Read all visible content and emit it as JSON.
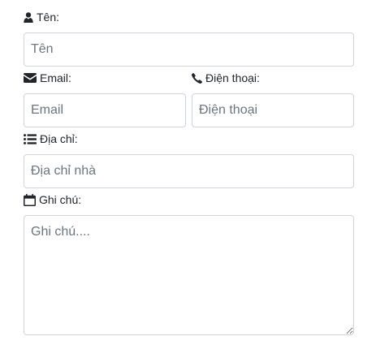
{
  "form": {
    "name": {
      "label": "Tên:",
      "placeholder": "Tên"
    },
    "email": {
      "label": "Email:",
      "placeholder": "Email"
    },
    "phone": {
      "label": "Điện thoại:",
      "placeholder": "Điện thoại"
    },
    "address": {
      "label": "Địa chỉ:",
      "placeholder": "Địa chỉ nhà"
    },
    "note": {
      "label": "Ghi chú:",
      "placeholder": "Ghi chú...."
    }
  },
  "icons": {
    "name": "user-icon",
    "email": "envelope-icon",
    "phone": "phone-icon",
    "address": "list-icon",
    "note": "calendar-icon"
  },
  "colors": {
    "text": "#212529",
    "placeholder": "#6c757d",
    "border": "#ced4da"
  }
}
